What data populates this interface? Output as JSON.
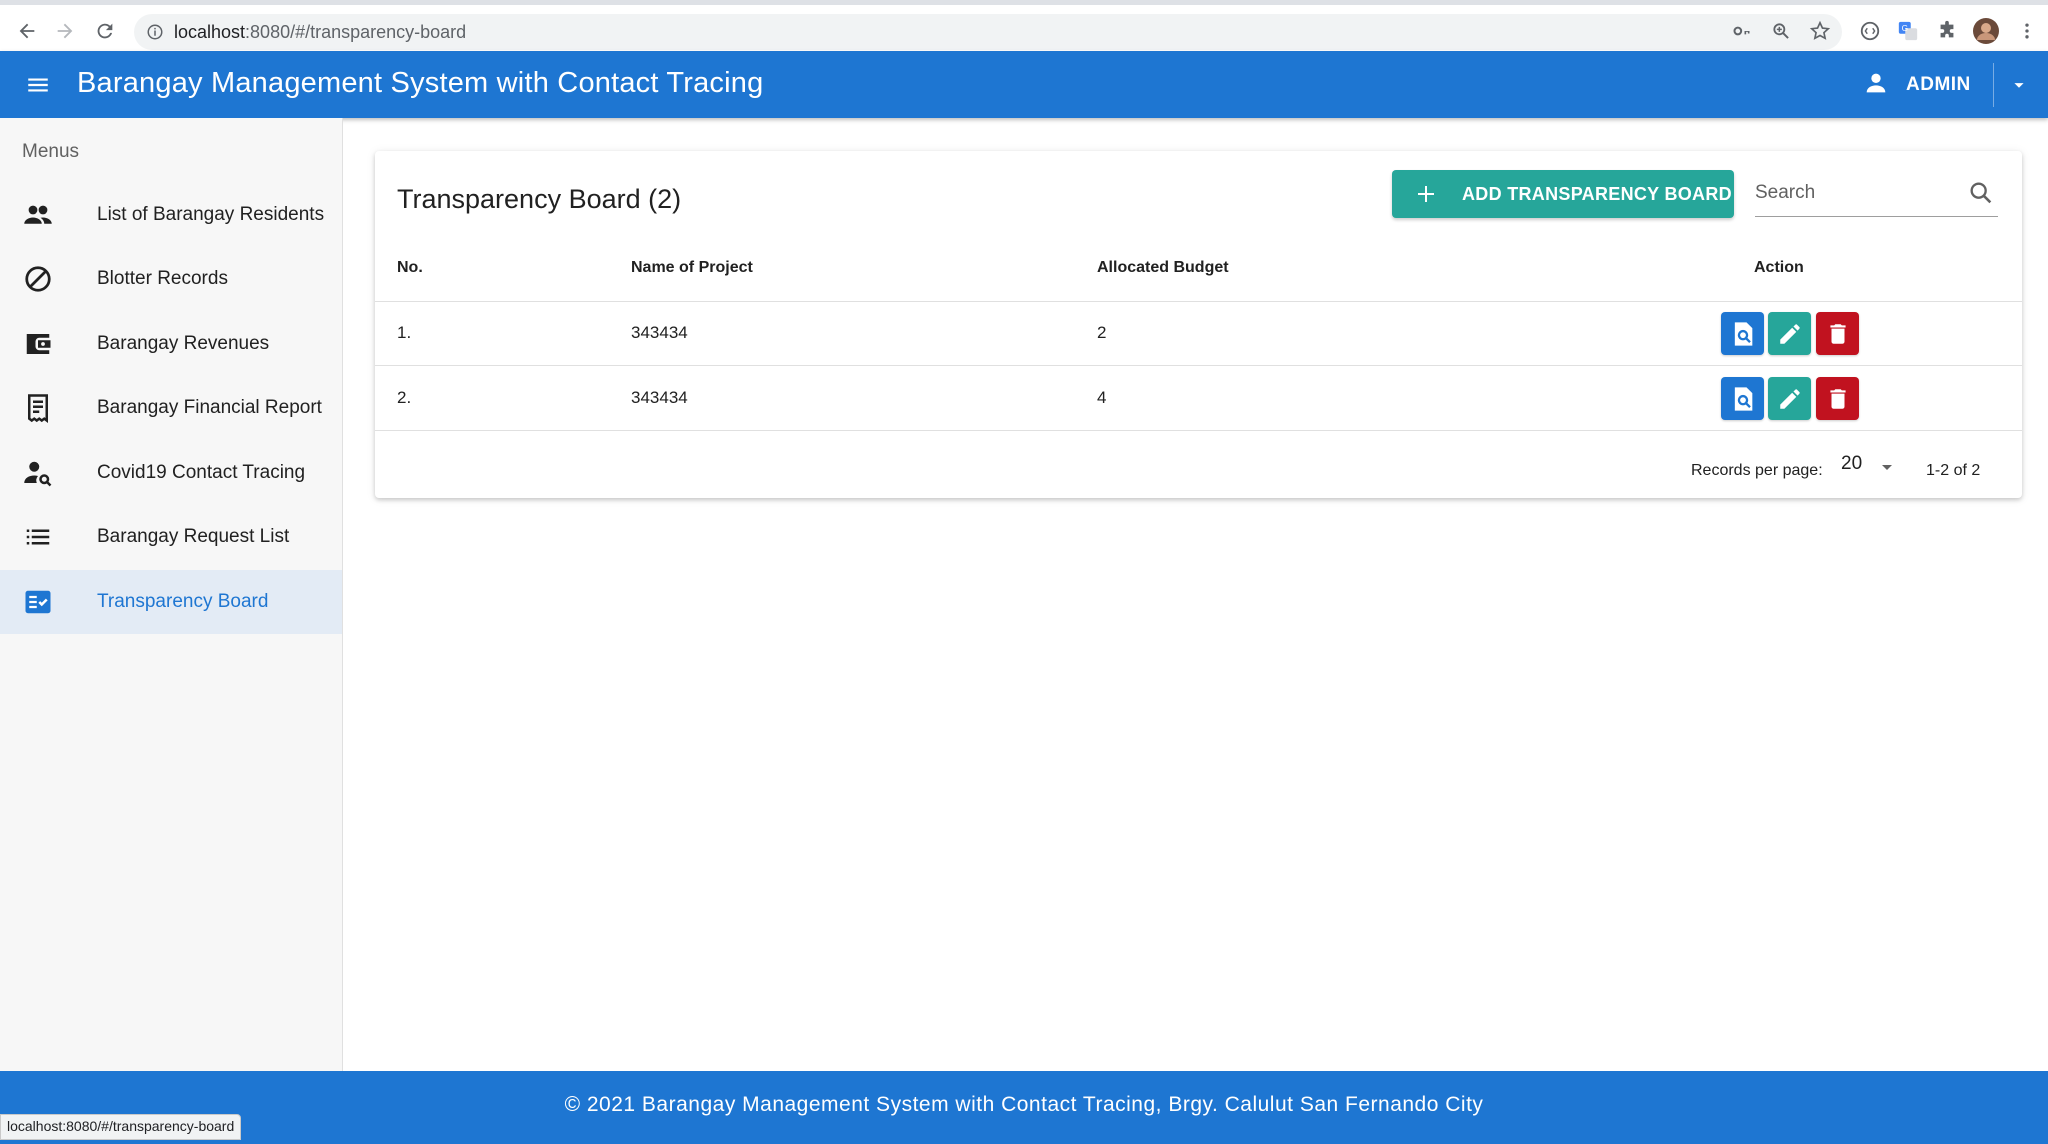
{
  "browser": {
    "url_host": "localhost",
    "url_rest": ":8080/#/transparency-board",
    "status_tooltip": "localhost:8080/#/transparency-board"
  },
  "appbar": {
    "title": "Barangay Management System with Contact Tracing",
    "user_label": "ADMIN"
  },
  "sidebar": {
    "heading": "Menus",
    "items": [
      {
        "label": "List of Barangay Residents",
        "icon": "people-icon"
      },
      {
        "label": "Blotter Records",
        "icon": "block-icon"
      },
      {
        "label": "Barangay Revenues",
        "icon": "wallet-icon"
      },
      {
        "label": "Barangay Financial Report",
        "icon": "receipt-icon"
      },
      {
        "label": "Covid19 Contact Tracing",
        "icon": "person-search-icon"
      },
      {
        "label": "Barangay Request List",
        "icon": "list-icon"
      },
      {
        "label": "Transparency Board",
        "icon": "fact-check-icon",
        "active": true
      }
    ]
  },
  "card": {
    "title": "Transparency Board (2)",
    "add_button_label": "ADD TRANSPARENCY BOARD",
    "search_placeholder": "Search",
    "columns": [
      "No.",
      "Name of Project",
      "Allocated Budget",
      "Action"
    ],
    "rows": [
      {
        "no": "1.",
        "name": "343434",
        "budget": "2"
      },
      {
        "no": "2.",
        "name": "343434",
        "budget": "4"
      }
    ],
    "records_per_page_label": "Records per page:",
    "records_per_page_value": "20",
    "pagination_text": "1-2 of 2"
  },
  "footer": {
    "text": "© 2021 Barangay Management System with Contact Tracing, Brgy. Calulut San Fernando City"
  },
  "colors": {
    "primary": "#1e76d2",
    "teal": "#26a69a",
    "danger": "#c1121f",
    "active_bg": "#e3ebf5"
  }
}
